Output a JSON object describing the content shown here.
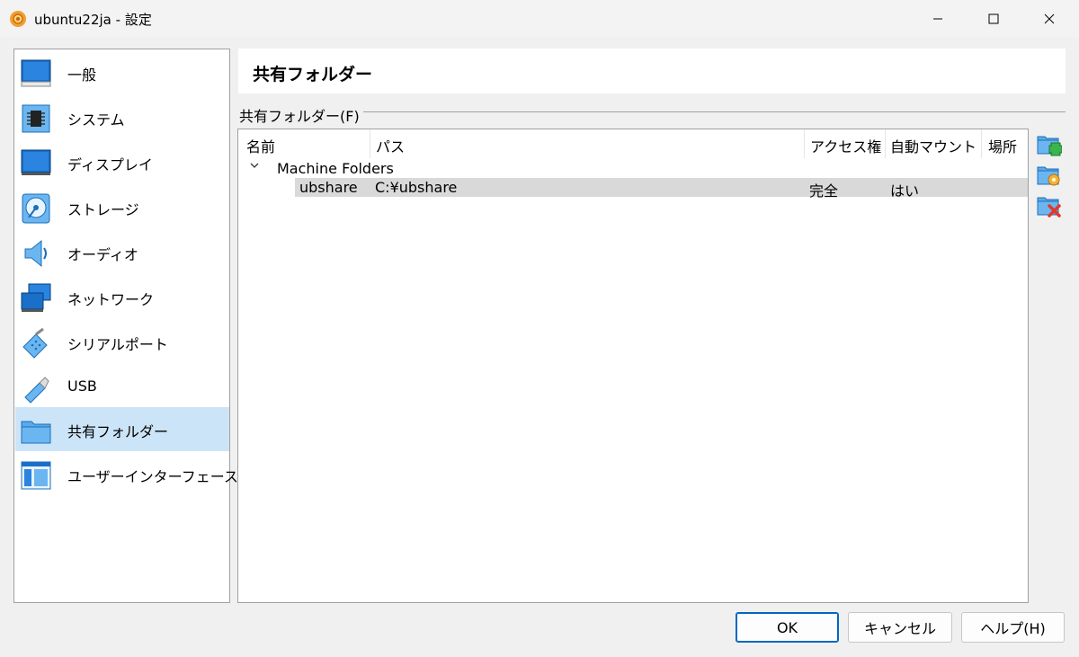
{
  "window": {
    "title": "ubuntu22ja - 設定"
  },
  "sidebar": {
    "items": [
      {
        "label": "一般",
        "icon": "monitor-icon",
        "selected": false
      },
      {
        "label": "システム",
        "icon": "chip-icon",
        "selected": false
      },
      {
        "label": "ディスプレイ",
        "icon": "display-icon",
        "selected": false
      },
      {
        "label": "ストレージ",
        "icon": "disk-icon",
        "selected": false
      },
      {
        "label": "オーディオ",
        "icon": "speaker-icon",
        "selected": false
      },
      {
        "label": "ネットワーク",
        "icon": "network-icon",
        "selected": false
      },
      {
        "label": "シリアルポート",
        "icon": "serial-port-icon",
        "selected": false
      },
      {
        "label": "USB",
        "icon": "usb-icon",
        "selected": false
      },
      {
        "label": "共有フォルダー",
        "icon": "folder-icon",
        "selected": true
      },
      {
        "label": "ユーザーインターフェース",
        "icon": "ui-icon",
        "selected": false
      }
    ]
  },
  "page": {
    "title": "共有フォルダー",
    "group_label": "共有フォルダー(F)"
  },
  "table": {
    "headers": {
      "name": "名前",
      "path": "パス",
      "access": "アクセス権",
      "automount": "自動マウント",
      "location": "場所"
    },
    "group": {
      "label": "Machine Folders",
      "expanded": true
    },
    "rows": [
      {
        "name": "ubshare",
        "path": "C:¥ubshare",
        "access": "完全",
        "automount": "はい",
        "location": ""
      }
    ]
  },
  "tools": {
    "add": "add-folder-icon",
    "edit": "edit-folder-icon",
    "remove": "remove-folder-icon"
  },
  "buttons": {
    "ok": "OK",
    "cancel": "キャンセル",
    "help": "ヘルプ(H)"
  },
  "colors": {
    "selected_sidebar": "#cce4f7",
    "selected_row": "#d9d9d9",
    "accent": "#0067c0"
  }
}
